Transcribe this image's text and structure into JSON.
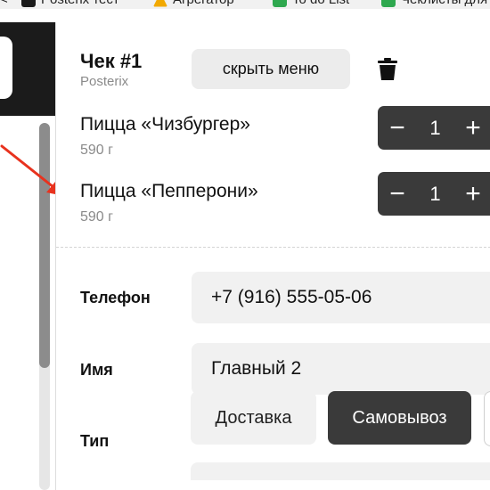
{
  "bookmarks": [
    {
      "label": "Posterix тест",
      "icon": "posterix-icon"
    },
    {
      "label": "Агрегатор",
      "icon": "aggregator-icon"
    },
    {
      "label": "To do List",
      "icon": "sheet-icon"
    },
    {
      "label": "Чеклисты для",
      "icon": "sheet-icon"
    }
  ],
  "receipt": {
    "title": "Чек #1",
    "subtitle": "Posterix",
    "hide_menu_label": "скрыть меню"
  },
  "items": [
    {
      "name": "Пицца «Чизбургер»",
      "weight": "590 г",
      "qty": "1"
    },
    {
      "name": "Пицца «Пепперони»",
      "weight": "590 г",
      "qty": "1"
    }
  ],
  "stepper": {
    "minus": "−",
    "plus": "+"
  },
  "form": {
    "phone_label": "Телефон",
    "phone_value": "+7 (916) 555-05-06",
    "name_label": "Имя",
    "name_value": "Главный 2",
    "type_label": "Тип",
    "type_options": [
      "Доставка",
      "Самовывоз"
    ],
    "type_selected": "Самовывоз"
  },
  "colors": {
    "dark": "#3a3a3a",
    "field_bg": "#f1f1f1",
    "annotation": "#e8321e"
  }
}
